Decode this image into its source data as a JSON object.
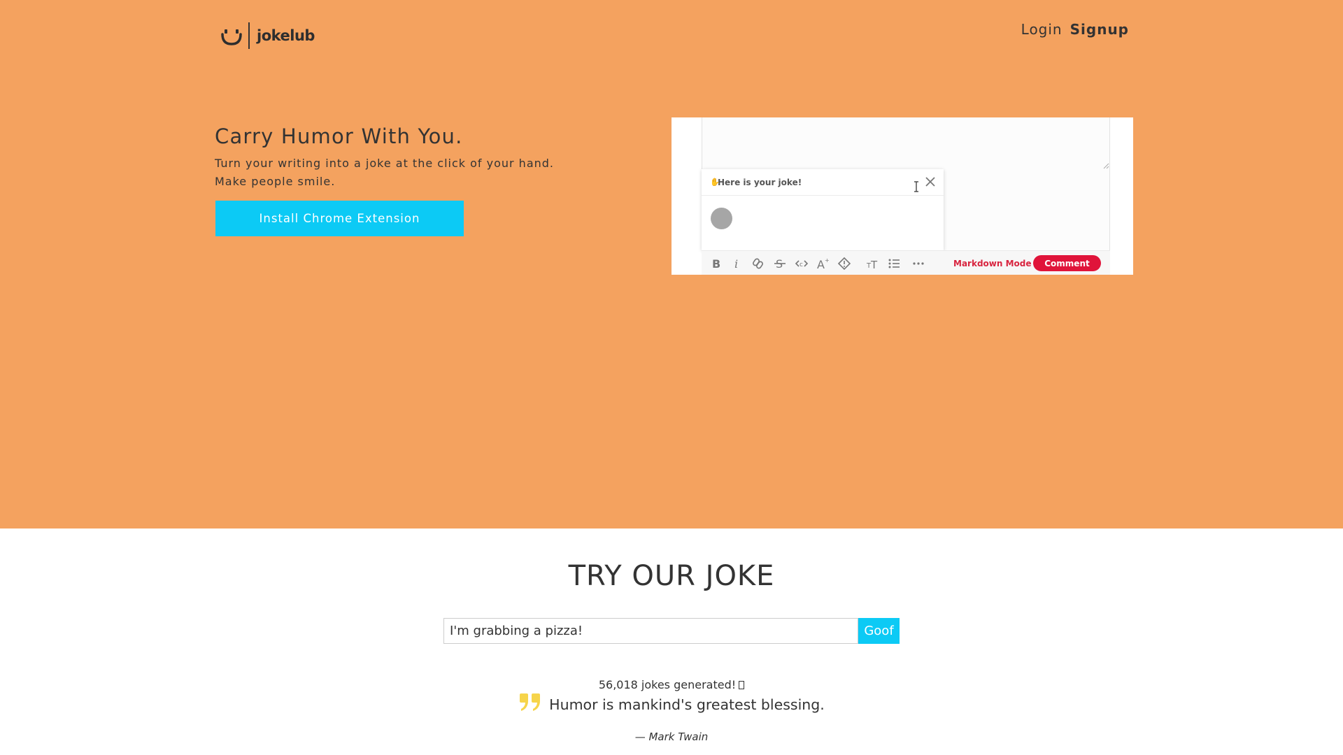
{
  "header": {
    "logo_text": "jokelub",
    "nav": [
      {
        "label": "Login"
      },
      {
        "label": "Signup"
      }
    ]
  },
  "hero": {
    "title": "Carry Humor With You.",
    "subtitle_line1": "Turn your writing into a joke at the click of your hand.",
    "subtitle_line2": "Make people smile.",
    "cta_label": "Install Chrome Extension"
  },
  "preview": {
    "popup_title": "Here is your joke!",
    "toolbar_icons": [
      "bold-icon",
      "italic-icon",
      "link-icon",
      "strikethrough-icon",
      "code-icon",
      "font-size-icon",
      "spoiler-icon",
      "heading-icon",
      "bullet-list-icon",
      "more-icon"
    ],
    "markdown_mode_label": "Markdown Mode",
    "comment_label": "Comment"
  },
  "try_section": {
    "title": "TRY OUR JOKE",
    "input_value": "I'm grabbing a pizza!",
    "submit_label": "Goof",
    "jokes_count_text": "56,018 jokes generated!",
    "quote_text": "Humor is mankind's greatest blessing.",
    "quote_dash": "—",
    "quote_author": "Mark Twain"
  },
  "colors": {
    "hero_background": "#f4a25f",
    "accent_cyan": "#0ccaf5",
    "comment_red": "#e0143a",
    "quote_yellow": "#f6d44a"
  }
}
